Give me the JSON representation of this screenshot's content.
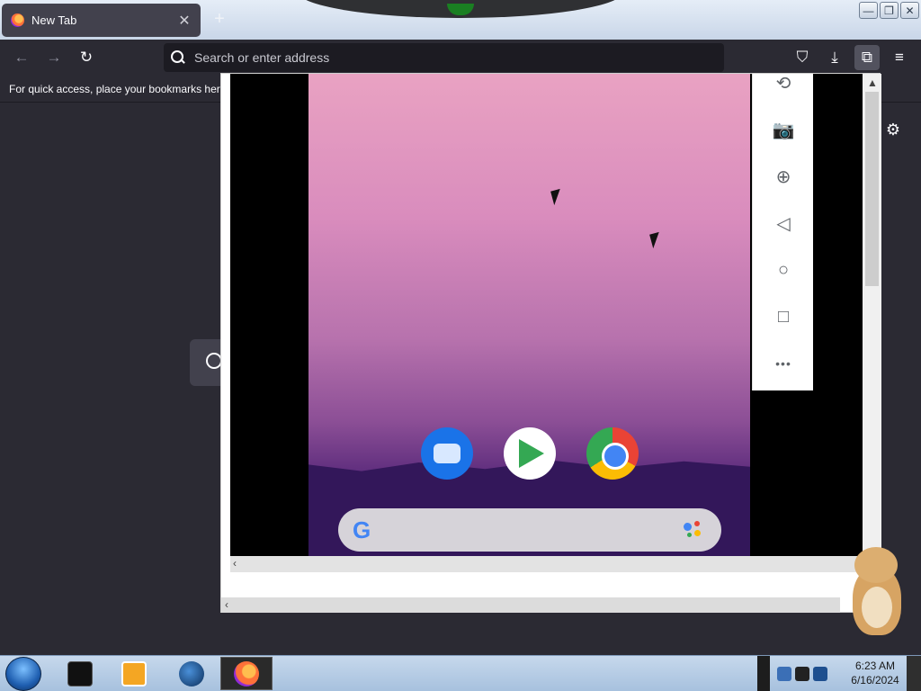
{
  "browser": {
    "tab": {
      "title": "New Tab",
      "close_glyph": "✕",
      "icon": "firefox-icon"
    },
    "new_tab_glyph": "+",
    "window_controls": {
      "minimize": "—",
      "maximize": "❐",
      "close": "✕"
    },
    "nav": {
      "back_glyph": "←",
      "forward_glyph": "→",
      "reload_glyph": "↻",
      "search_placeholder": "Search or enter address",
      "pocket_glyph": "⛉",
      "download_glyph": "⤓",
      "extensions_glyph": "⧉",
      "menu_glyph": "≡"
    },
    "bookmarks_hint": "For quick access, place your bookmarks here",
    "settings_glyph": "⚙"
  },
  "emulator": {
    "tools": [
      {
        "name": "rotate-icon",
        "glyph": "⟲"
      },
      {
        "name": "camera-icon",
        "glyph": "📷"
      },
      {
        "name": "zoom-icon",
        "glyph": "⊕"
      },
      {
        "name": "back-icon",
        "glyph": "◁"
      },
      {
        "name": "home-icon",
        "glyph": "○"
      },
      {
        "name": "overview-icon",
        "glyph": "□"
      },
      {
        "name": "more-icon",
        "glyph": "•••"
      }
    ],
    "apps": [
      "messages-app-icon",
      "play-store-app-icon",
      "chrome-app-icon"
    ],
    "google_letter": "G",
    "scroll_up": "▲",
    "scroll_left": "‹"
  },
  "taskbar": {
    "clock_time": "6:23 AM",
    "clock_date": "6/16/2024"
  }
}
